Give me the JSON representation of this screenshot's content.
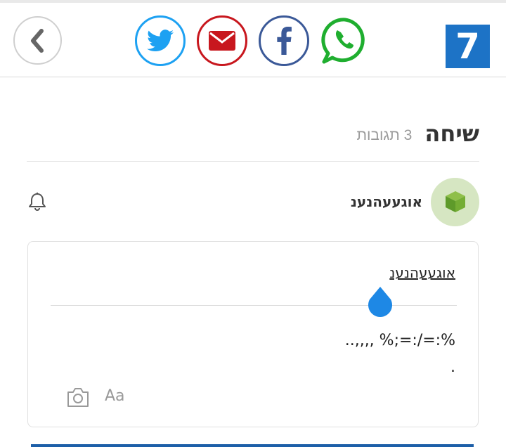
{
  "header": {
    "back_icon": "chevron-left-icon",
    "share": [
      {
        "name": "twitter",
        "icon": "twitter-icon",
        "color": "#1da1f2"
      },
      {
        "name": "email",
        "icon": "mail-icon",
        "color": "#c8171e"
      },
      {
        "name": "facebook",
        "icon": "facebook-icon",
        "color": "#3b5998"
      },
      {
        "name": "whatsapp",
        "icon": "whatsapp-icon",
        "color": "#1fae2f"
      }
    ],
    "logo_text": "7",
    "logo_color": "#1d73c6"
  },
  "discussion": {
    "title": "שיחה",
    "reply_count": "3 תגובות"
  },
  "user": {
    "name": "אוגעעהנענ",
    "avatar_icon": "cube-icon",
    "bell_icon": "bell-icon"
  },
  "editor": {
    "quote_name": "אוגעעהנענ",
    "comment_text": "%:=/:=;% ,,,,..\n.",
    "camera_icon": "camera-icon",
    "font_label": "Aa",
    "handle_color": "#1e88e5"
  }
}
